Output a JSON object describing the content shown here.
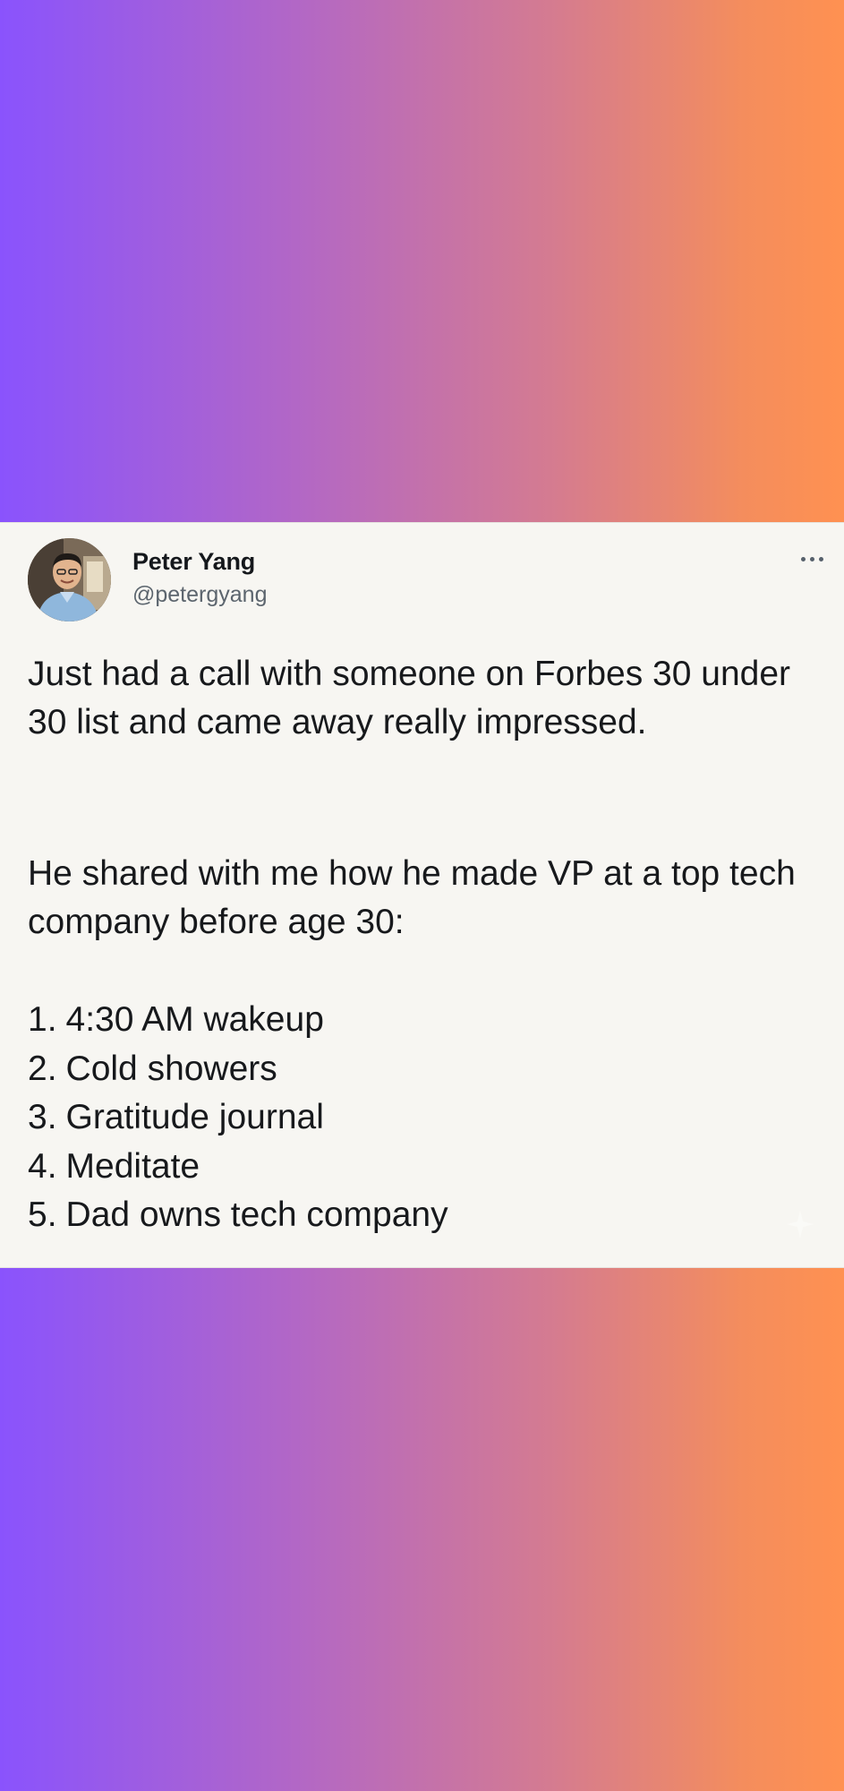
{
  "tweet": {
    "author_name": "Peter Yang",
    "author_handle": "@petergyang",
    "paragraph_1": "Just had a call with someone on Forbes 30 under 30 list and came away really impressed.",
    "paragraph_2": "He shared with me how he made VP at a top tech company before age 30:",
    "list": [
      {
        "num": "1.",
        "text": "4:30 AM wakeup"
      },
      {
        "num": "2.",
        "text": "Cold showers"
      },
      {
        "num": "3.",
        "text": "Gratitude journal"
      },
      {
        "num": "4.",
        "text": "Meditate"
      },
      {
        "num": "5.",
        "text": "Dad owns tech company"
      }
    ],
    "more_icon": "more-horizontal-icon"
  },
  "colors": {
    "gradient_start": "#8a53fd",
    "gradient_end": "#ff9151",
    "card_background": "#f7f6f2",
    "text_primary": "#17191c",
    "text_secondary": "#5c656e"
  }
}
